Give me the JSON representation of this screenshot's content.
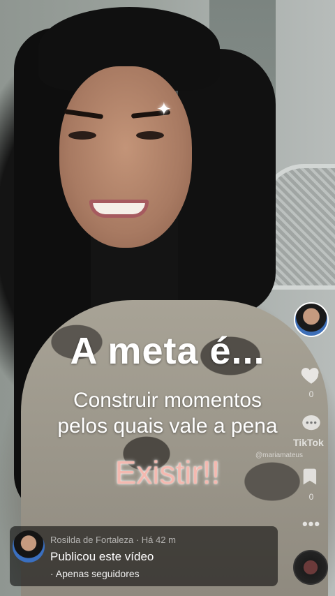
{
  "overlay": {
    "title": "A meta é...",
    "line1": "Construir momentos",
    "line2": "pelos quais vale a pena",
    "highlight": "Existir!!"
  },
  "watermark": {
    "brand": "TikTok",
    "handle": "@mariamateus"
  },
  "side_actions": {
    "like_count": "0",
    "share_count": "0"
  },
  "notice": {
    "meta": "Rosilda de Fortaleza · Há 42 m",
    "title": "Publicou este vídeo",
    "audience": "· Apenas seguidores"
  },
  "colors": {
    "highlight": "#f4b9b0",
    "notice_bg": "rgba(0,0,0,0.55)"
  },
  "icons": [
    "heart-icon",
    "comment-icon",
    "share-icon",
    "more-icon",
    "music-disc-icon"
  ]
}
